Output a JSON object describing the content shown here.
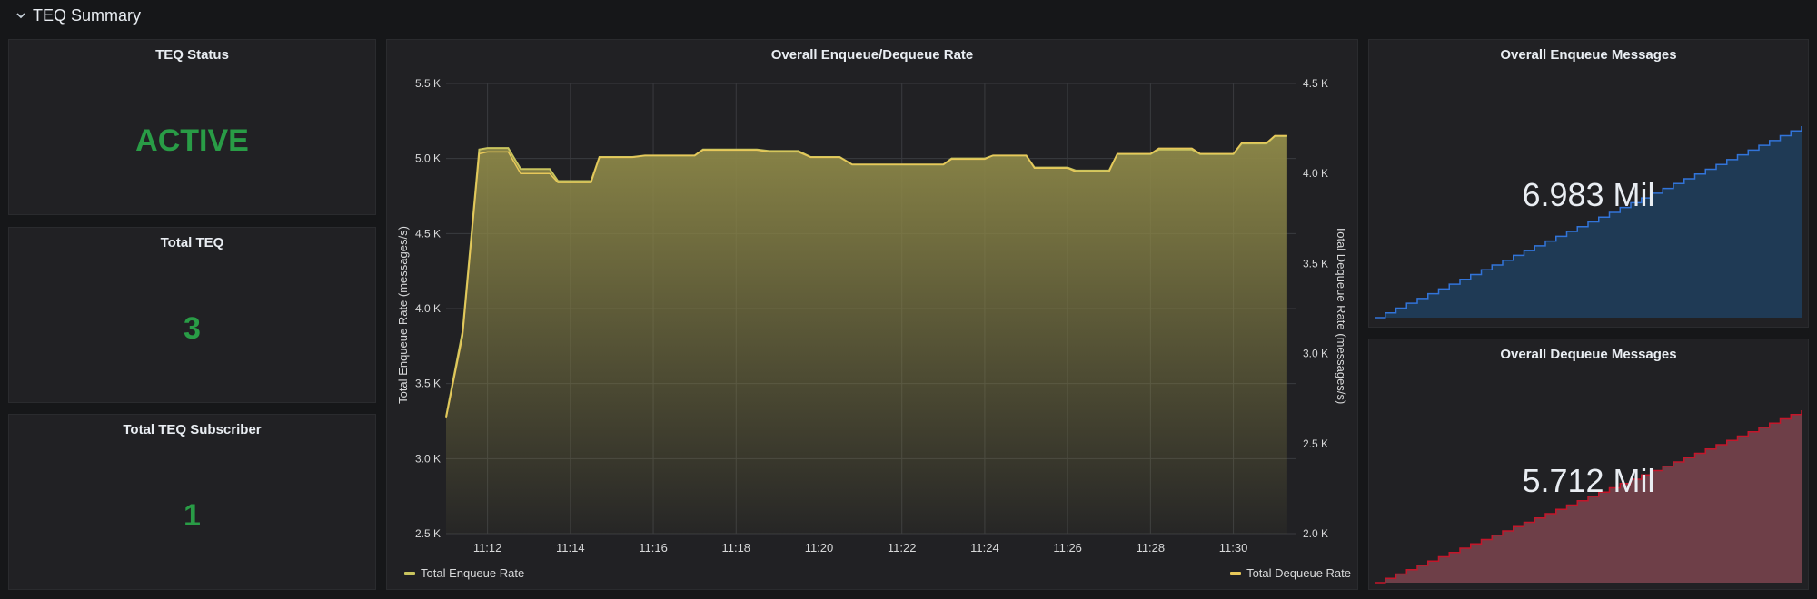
{
  "row": {
    "title": "TEQ Summary"
  },
  "panels": {
    "status": {
      "title": "TEQ Status",
      "value": "ACTIVE"
    },
    "total_teq": {
      "title": "Total TEQ",
      "value": "3"
    },
    "subscriber": {
      "title": "Total TEQ Subscriber",
      "value": "1"
    },
    "rate": {
      "title": "Overall Enqueue/Dequeue Rate",
      "legend": [
        {
          "name": "Total Enqueue Rate",
          "color": "#c9c45e"
        },
        {
          "name": "Total Dequeue Rate",
          "color": "#e8c85a"
        }
      ]
    },
    "enqueue_msgs": {
      "title": "Overall Enqueue Messages",
      "value": "6.983 Mil",
      "color": "#3274d9"
    },
    "dequeue_msgs": {
      "title": "Overall Dequeue Messages",
      "value": "5.712 Mil",
      "color": "#c4162a"
    }
  },
  "colors": {
    "active_green": "#299c46",
    "enqueue_fill": "#7f7a3c",
    "dequeue_fill": "#6e3f48",
    "enqueue_spark_fill": "#1f3a55"
  },
  "chart_data": [
    {
      "type": "area",
      "title": "Overall Enqueue/Dequeue Rate",
      "ylabel": "Total Enqueue Rate (messages/s)",
      "y2label": "Total Dequeue Rate (messages/s)",
      "ylim": [
        2500,
        5500
      ],
      "y2lim": [
        2000,
        4500
      ],
      "yticks": [
        "2.5 K",
        "3.0 K",
        "3.5 K",
        "4.0 K",
        "4.5 K",
        "5.0 K",
        "5.5 K"
      ],
      "y2ticks": [
        "2.0 K",
        "2.5 K",
        "3.0 K",
        "3.5 K",
        "4.0 K",
        "4.5 K"
      ],
      "xlim": [
        11.0,
        31.5
      ],
      "xticks": [
        "11:12",
        "11:14",
        "11:16",
        "11:18",
        "11:20",
        "11:22",
        "11:24",
        "11:26",
        "11:28",
        "11:30"
      ],
      "xtick_values": [
        12,
        14,
        16,
        18,
        20,
        22,
        24,
        26,
        28,
        30
      ],
      "grid": true,
      "legend_position": "bottom",
      "series": [
        {
          "name": "Total Enqueue Rate",
          "x": [
            11.0,
            11.4,
            11.8,
            12.0,
            12.5,
            12.8,
            13.5,
            13.7,
            14.5,
            14.7,
            15.5,
            15.8,
            17.0,
            17.2,
            18.5,
            18.8,
            19.5,
            19.8,
            20.5,
            20.8,
            22.0,
            22.2,
            23.0,
            23.2,
            24.0,
            24.2,
            25.0,
            25.2,
            26.0,
            26.2,
            27.0,
            27.2,
            28.0,
            28.2,
            29.0,
            29.2,
            30.0,
            30.2,
            30.8,
            31.0,
            31.3
          ],
          "values": [
            3280,
            3850,
            5060,
            5070,
            5070,
            4930,
            4930,
            4850,
            4850,
            5010,
            5010,
            5020,
            5020,
            5060,
            5060,
            5050,
            5050,
            5010,
            5010,
            4960,
            4960,
            4960,
            4960,
            5000,
            5000,
            5020,
            5020,
            4940,
            4940,
            4920,
            4920,
            5030,
            5030,
            5060,
            5060,
            5030,
            5030,
            5100,
            5100,
            5150,
            5150
          ]
        },
        {
          "name": "Total Dequeue Rate",
          "x": [
            11.0,
            11.4,
            11.8,
            12.0,
            12.5,
            12.8,
            13.5,
            13.7,
            14.5,
            14.7,
            15.5,
            15.8,
            17.0,
            17.2,
            18.5,
            18.8,
            19.5,
            19.8,
            20.5,
            20.8,
            22.0,
            22.2,
            23.0,
            23.2,
            24.0,
            24.2,
            25.0,
            25.2,
            26.0,
            26.2,
            27.0,
            27.2,
            28.0,
            28.2,
            29.0,
            29.2,
            30.0,
            30.2,
            30.8,
            31.0,
            31.3
          ],
          "values": [
            2640,
            3100,
            4110,
            4120,
            4120,
            4000,
            4000,
            3950,
            3950,
            4090,
            4090,
            4100,
            4100,
            4130,
            4130,
            4120,
            4120,
            4090,
            4090,
            4050,
            4050,
            4050,
            4050,
            4080,
            4080,
            4100,
            4100,
            4030,
            4030,
            4010,
            4010,
            4110,
            4110,
            4140,
            4140,
            4110,
            4110,
            4170,
            4170,
            4210,
            4210
          ]
        }
      ]
    },
    {
      "type": "area",
      "title": "Overall Enqueue Messages",
      "value": "6.983 Mil",
      "series": [
        {
          "values": [
            0,
            0.5,
            1,
            1.5,
            2,
            2.5,
            3,
            3.5,
            4,
            4.5,
            5,
            5.5,
            6,
            6.5,
            7,
            7.5,
            8,
            8.5,
            9,
            9.5,
            10,
            10.5,
            11,
            11.5,
            12,
            12.5,
            13,
            13.5,
            14,
            14.5,
            15,
            15.5,
            16,
            16.5,
            17,
            17.5,
            18,
            18.5,
            19,
            19.5,
            20
          ]
        }
      ]
    },
    {
      "type": "area",
      "title": "Overall Dequeue Messages",
      "value": "5.712 Mil",
      "series": [
        {
          "values": [
            0,
            0.5,
            1,
            1.5,
            2,
            2.5,
            3,
            3.5,
            4,
            4.5,
            5,
            5.5,
            6,
            6.5,
            7,
            7.5,
            8,
            8.5,
            9,
            9.5,
            10,
            10.5,
            11,
            11.5,
            12,
            12.5,
            13,
            13.5,
            14,
            14.5,
            15,
            15.5,
            16,
            16.5,
            17,
            17.5,
            18,
            18.5,
            19,
            19.5,
            20
          ]
        }
      ]
    }
  ]
}
